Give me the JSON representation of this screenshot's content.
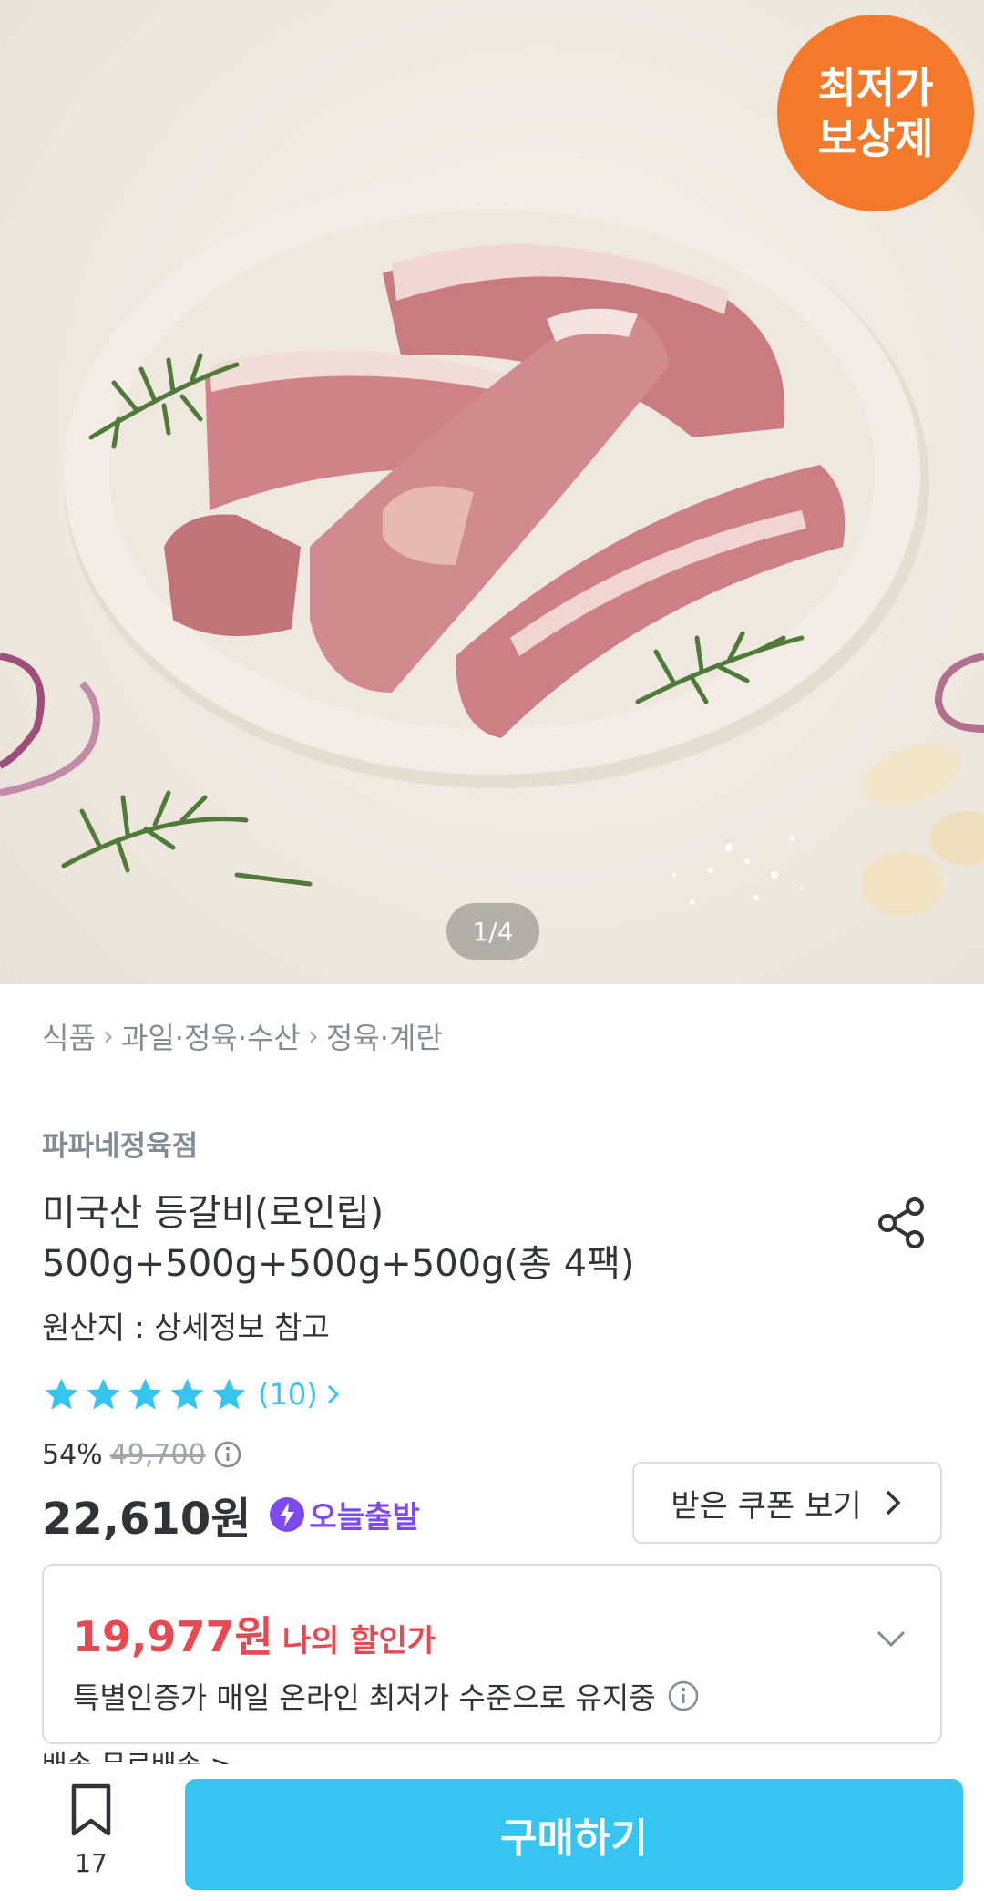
{
  "hero": {
    "badge_line1": "최저가",
    "badge_line2": "보상제",
    "pager": "1/4",
    "badge_color": "#f27a2a"
  },
  "breadcrumb": {
    "items": [
      "식품",
      "과일·정육·수산",
      "정육·계란"
    ]
  },
  "product": {
    "store": "파파네정육점",
    "title_line1": "미국산 등갈비(로인립)",
    "title_line2": "500g+500g+500g+500g(총 4팩)",
    "origin": "원산지 : 상세정보 참고",
    "rating": 5,
    "review_count": "(10)",
    "discount_rate": "54%",
    "original_price": "49,700",
    "price": "22,610원",
    "today_delivery": "오늘출발"
  },
  "coupon": {
    "label": "받은 쿠폰 보기"
  },
  "my_deal": {
    "amount": "19,977원",
    "label": "나의 할인가",
    "description": "특별인증가 매일 온라인 최저가 수준으로 유지중"
  },
  "peek": {
    "text": "배송    무료배송 >"
  },
  "bottom_bar": {
    "bookmark_count": "17",
    "buy_label": "구매하기"
  },
  "colors": {
    "accent": "#35c5f0",
    "sale_red": "#e8484f",
    "today_purple": "#7d4af0"
  }
}
